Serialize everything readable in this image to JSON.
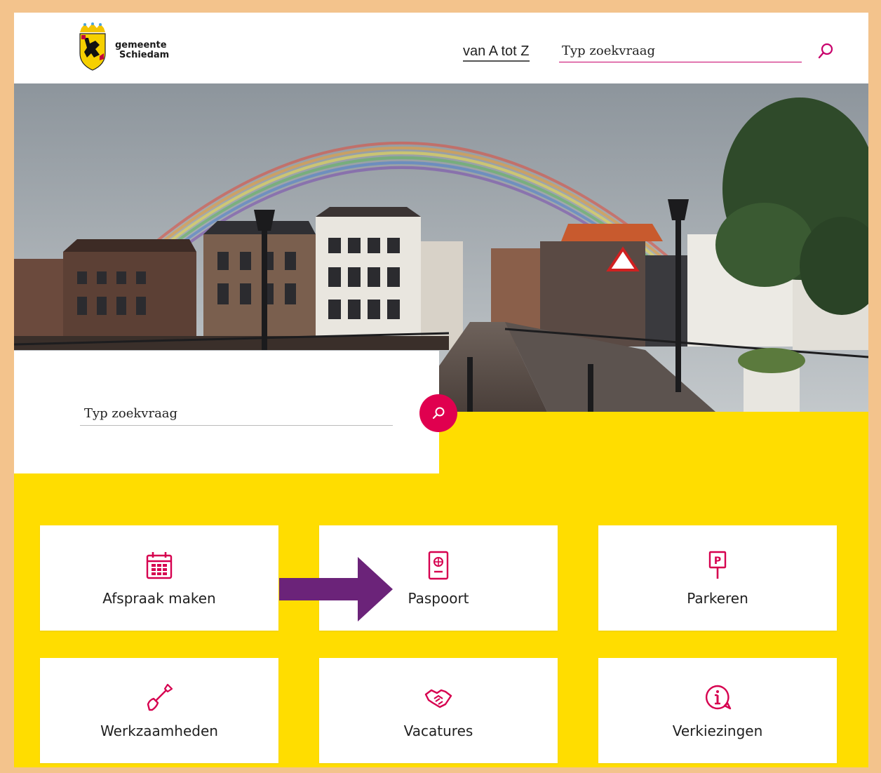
{
  "header": {
    "logo_line1": "gemeente",
    "logo_line2": "Schiedam",
    "nav_atoz": "van A tot Z",
    "search_placeholder": "Typ zoekvraag"
  },
  "hero": {
    "search_placeholder": "Typ zoekvraag"
  },
  "tiles": [
    {
      "label": "Afspraak maken",
      "icon": "calendar-icon"
    },
    {
      "label": "Paspoort",
      "icon": "passport-icon"
    },
    {
      "label": "Parkeren",
      "icon": "parking-sign-icon"
    },
    {
      "label": "Werkzaamheden",
      "icon": "shovel-icon"
    },
    {
      "label": "Vacatures",
      "icon": "handshake-icon"
    },
    {
      "label": "Verkiezingen",
      "icon": "info-icon"
    }
  ],
  "colors": {
    "accent": "#e0004f",
    "yellow": "#ffdd00",
    "frame": "#f3c38c",
    "arrow": "#6b2379"
  }
}
